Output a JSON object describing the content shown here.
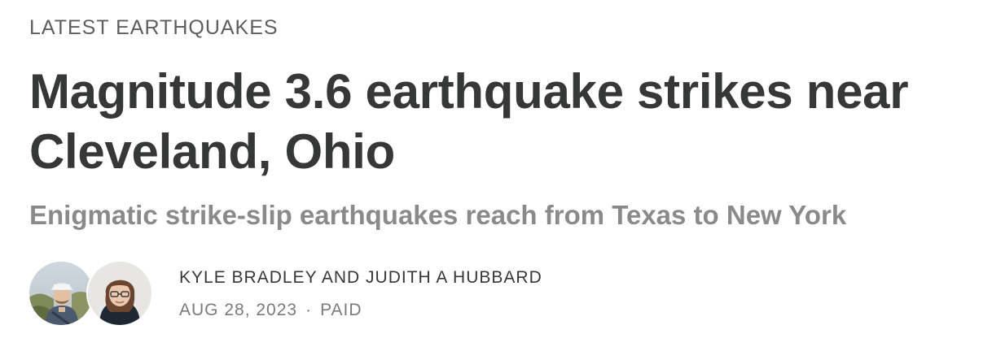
{
  "section": {
    "label": "LATEST EARTHQUAKES"
  },
  "post": {
    "title": "Magnitude 3.6 earthquake strikes near Cleveland, Ohio",
    "subtitle": "Enigmatic strike-slip earthquakes reach from Texas to New York"
  },
  "byline": {
    "authors": "KYLE BRADLEY AND JUDITH A HUBBARD",
    "date": "AUG 28, 2023",
    "separator": "·",
    "access": "PAID",
    "avatars": [
      {
        "icon": "author-avatar-kyle-bradley"
      },
      {
        "icon": "author-avatar-judith-hubbard"
      }
    ]
  },
  "colors": {
    "text_primary": "#363737",
    "text_secondary": "#8a8a8a",
    "text_meta": "#7a7a7a",
    "background": "#ffffff"
  }
}
